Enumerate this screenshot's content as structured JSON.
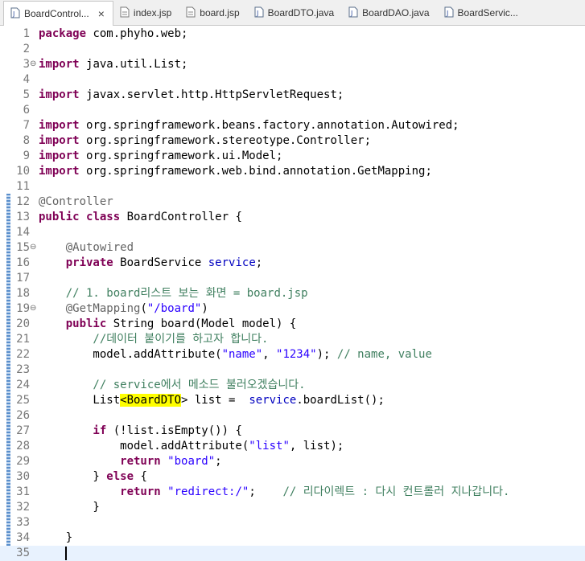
{
  "tabs": [
    {
      "label": "BoardControl...",
      "icon": "java-file-icon",
      "active": true,
      "closable": true
    },
    {
      "label": "index.jsp",
      "icon": "jsp-file-icon"
    },
    {
      "label": "board.jsp",
      "icon": "jsp-file-icon"
    },
    {
      "label": "BoardDTO.java",
      "icon": "java-file-icon"
    },
    {
      "label": "BoardDAO.java",
      "icon": "java-file-icon"
    },
    {
      "label": "BoardServic...",
      "icon": "java-file-icon"
    }
  ],
  "close_glyph": "×",
  "current_line": 35,
  "lines": [
    {
      "n": "1",
      "tokens": [
        [
          "kw",
          "package"
        ],
        [
          "",
          "com.phyho.web;"
        ]
      ]
    },
    {
      "n": "2",
      "tokens": []
    },
    {
      "n": "3",
      "fold": "⊖",
      "tokens": [
        [
          "kw",
          "import"
        ],
        [
          "",
          "java.util.List;"
        ]
      ]
    },
    {
      "n": "4",
      "tokens": []
    },
    {
      "n": "5",
      "tokens": [
        [
          "kw",
          "import"
        ],
        [
          "",
          "javax.servlet.http.HttpServletRequest;"
        ]
      ]
    },
    {
      "n": "6",
      "tokens": []
    },
    {
      "n": "7",
      "tokens": [
        [
          "kw",
          "import"
        ],
        [
          "",
          "org.springframework.beans.factory.annotation.Autowired;"
        ]
      ]
    },
    {
      "n": "8",
      "tokens": [
        [
          "kw",
          "import"
        ],
        [
          "",
          "org.springframework.stereotype.Controller;"
        ]
      ]
    },
    {
      "n": "9",
      "tokens": [
        [
          "kw",
          "import"
        ],
        [
          "",
          "org.springframework.ui.Model;"
        ]
      ]
    },
    {
      "n": "10",
      "tokens": [
        [
          "kw",
          "import"
        ],
        [
          "",
          "org.springframework.web.bind.annotation.GetMapping;"
        ]
      ]
    },
    {
      "n": "11",
      "tokens": []
    },
    {
      "n": "12",
      "tokens": [
        [
          "ann",
          "@Controller"
        ]
      ]
    },
    {
      "n": "13",
      "tokens": [
        [
          "kw",
          "public"
        ],
        [
          "kw",
          "class"
        ],
        [
          "",
          "BoardController {"
        ]
      ]
    },
    {
      "n": "14",
      "tokens": []
    },
    {
      "n": "15",
      "fold": "⊖",
      "tokens": [
        [
          "ann",
          "    @Autowired"
        ]
      ]
    },
    {
      "n": "16",
      "tokens": [
        [
          "kw",
          "    private"
        ],
        [
          "",
          "BoardService"
        ],
        [
          "fld",
          "service"
        ],
        [
          "",
          ";"
        ]
      ]
    },
    {
      "n": "17",
      "tokens": []
    },
    {
      "n": "18",
      "tokens": [
        [
          "cm",
          "    // 1. board리스트 보는 화면 = board.jsp"
        ]
      ]
    },
    {
      "n": "19",
      "fold": "⊖",
      "tokens": [
        [
          "ann",
          "    @GetMapping"
        ],
        [
          "",
          "("
        ],
        [
          "str",
          "\"/board\""
        ],
        [
          "",
          ")"
        ]
      ]
    },
    {
      "n": "20",
      "tokens": [
        [
          "kw",
          "    public"
        ],
        [
          "",
          "String board(Model model) {"
        ]
      ]
    },
    {
      "n": "21",
      "tokens": [
        [
          "cm",
          "        //데이터 붙이기를 하고자 합니다."
        ]
      ]
    },
    {
      "n": "22",
      "tokens": [
        [
          "",
          "        model.addAttribute("
        ],
        [
          "str",
          "\"name\""
        ],
        [
          "",
          ", "
        ],
        [
          "str",
          "\"1234\""
        ],
        [
          "",
          "); "
        ],
        [
          "cm",
          "// name, value"
        ]
      ]
    },
    {
      "n": "23",
      "tokens": []
    },
    {
      "n": "24",
      "tokens": [
        [
          "cm",
          "        // service에서 메소드 불러오겠습니다."
        ]
      ]
    },
    {
      "n": "25",
      "tokens": [
        [
          "",
          "        List"
        ],
        [
          "hl",
          "<BoardDTO"
        ],
        [
          "",
          "> list = "
        ],
        [
          "fld",
          "service"
        ],
        [
          "",
          ".boardList();"
        ]
      ]
    },
    {
      "n": "26",
      "tokens": []
    },
    {
      "n": "27",
      "tokens": [
        [
          "kw",
          "        if"
        ],
        [
          "",
          "(!list.isEmpty()) {"
        ]
      ]
    },
    {
      "n": "28",
      "tokens": [
        [
          "",
          "            model.addAttribute("
        ],
        [
          "str",
          "\"list\""
        ],
        [
          "",
          ", list);"
        ]
      ]
    },
    {
      "n": "29",
      "tokens": [
        [
          "kw",
          "            return"
        ],
        [
          "str",
          "\"board\""
        ],
        [
          "",
          ";"
        ]
      ]
    },
    {
      "n": "30",
      "tokens": [
        [
          "",
          "        } "
        ],
        [
          "kw",
          "else"
        ],
        [
          "",
          "{"
        ]
      ]
    },
    {
      "n": "31",
      "tokens": [
        [
          "kw",
          "            return"
        ],
        [
          "str",
          "\"redirect:/\""
        ],
        [
          "",
          ";    "
        ],
        [
          "cm",
          "// 리다이렉트 : 다시 컨트롤러 지나갑니다."
        ]
      ]
    },
    {
      "n": "32",
      "tokens": [
        [
          "",
          "        }"
        ]
      ]
    },
    {
      "n": "33",
      "tokens": []
    },
    {
      "n": "34",
      "tokens": [
        [
          "",
          "    }"
        ]
      ]
    },
    {
      "n": "35",
      "tokens": []
    }
  ]
}
